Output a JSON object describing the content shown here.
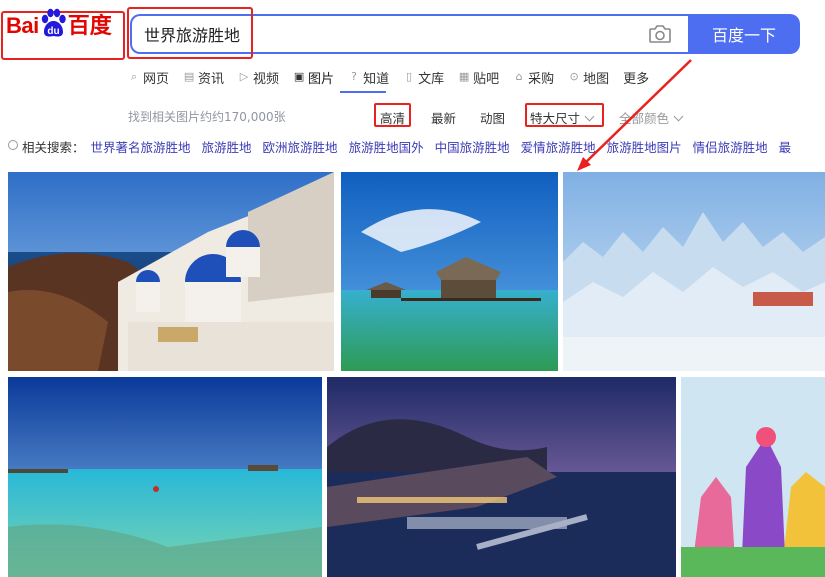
{
  "logo": {
    "text_bai": "Bai",
    "text_du": "du",
    "text_cn": "百度"
  },
  "search": {
    "value": "世界旅游胜地",
    "button_label": "百度一下"
  },
  "tabs": [
    {
      "label": "网页",
      "icon": "search-icon"
    },
    {
      "label": "资讯",
      "icon": "news-icon"
    },
    {
      "label": "视频",
      "icon": "video-icon"
    },
    {
      "label": "图片",
      "icon": "image-icon",
      "active": true
    },
    {
      "label": "知道",
      "icon": "question-icon"
    },
    {
      "label": "文库",
      "icon": "doc-icon"
    },
    {
      "label": "贴吧",
      "icon": "forum-icon"
    },
    {
      "label": "采购",
      "icon": "shop-icon"
    },
    {
      "label": "地图",
      "icon": "map-icon"
    },
    {
      "label": "更多"
    }
  ],
  "filters": {
    "result_count": "找到相关图片约约170,000张",
    "hd": "高清",
    "latest": "最新",
    "animated": "动图",
    "size": "特大尺寸",
    "color": "全部颜色"
  },
  "related": {
    "label": "相关搜索：",
    "queries": [
      "世界著名旅游胜地",
      "旅游胜地",
      "欧洲旅游胜地",
      "旅游胜地国外",
      "中国旅游胜地",
      "爱情旅游胜地",
      "旅游胜地图片",
      "情侣旅游胜地",
      "最"
    ]
  },
  "colors": {
    "accent": "#4e6ef2",
    "highlight": "#e8231f",
    "link": "#3b3ab5"
  }
}
